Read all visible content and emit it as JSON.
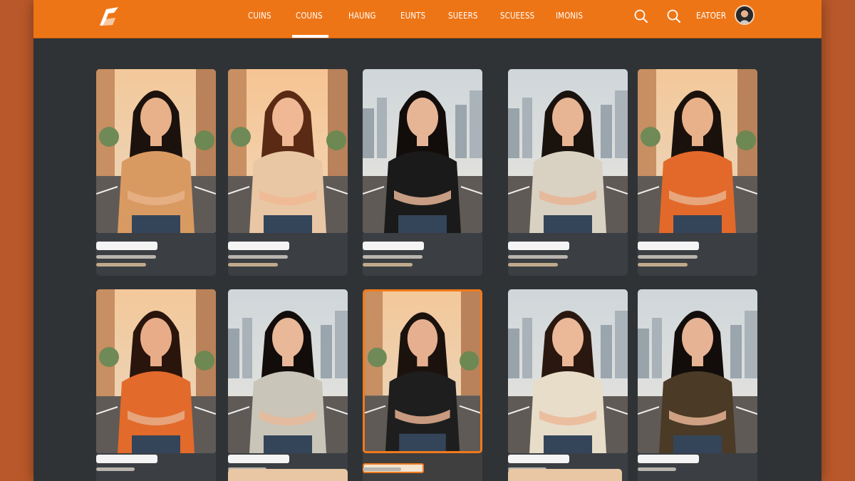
{
  "nav": {
    "items": [
      {
        "label": "CUINS"
      },
      {
        "label": "COUNS"
      },
      {
        "label": "HAUNG"
      },
      {
        "label": "EUNTS"
      },
      {
        "label": "SUEERS"
      },
      {
        "label": "SCUEESS"
      },
      {
        "label": "IMONIS"
      }
    ],
    "active_index": 1,
    "user_label": "EATOER"
  },
  "icons": {
    "logo": "brand-logo",
    "search_1": "search-icon",
    "search_2": "search-icon",
    "avatar": "user-avatar"
  },
  "colors": {
    "accent": "#ee7516",
    "background": "#2f3336",
    "card": "#3b3f43",
    "selected_border": "#f07a1c"
  },
  "profiles": [
    {
      "id": 1,
      "top": "#d99a62",
      "hair": "#1c120d",
      "skin": "#e8b189",
      "backdrop": "street",
      "selected": false
    },
    {
      "id": 2,
      "top": "#e9c6a4",
      "hair": "#5a2a14",
      "skin": "#f0b894",
      "backdrop": "sunset",
      "selected": false
    },
    {
      "id": 3,
      "top": "#1a1a1a",
      "hair": "#120d0a",
      "skin": "#e6b596",
      "backdrop": "city",
      "selected": false
    },
    {
      "id": 4,
      "top": "#d9d2c3",
      "hair": "#1a120d",
      "skin": "#e8b594",
      "backdrop": "city",
      "selected": false
    },
    {
      "id": 5,
      "top": "#e3692a",
      "hair": "#1a110c",
      "skin": "#e8b189",
      "backdrop": "street",
      "selected": false
    },
    {
      "id": 6,
      "top": "#e26a2b",
      "hair": "#2a150c",
      "skin": "#e8ad88",
      "backdrop": "street",
      "selected": false
    },
    {
      "id": 7,
      "top": "#c9c6b9",
      "hair": "#120d0a",
      "skin": "#e8b899",
      "backdrop": "city",
      "selected": false
    },
    {
      "id": 8,
      "top": "#1e1e1e",
      "hair": "#1c120d",
      "skin": "#e6b090",
      "backdrop": "street",
      "selected": true
    },
    {
      "id": 9,
      "top": "#e8ddc8",
      "hair": "#2a1810",
      "skin": "#ebb898",
      "backdrop": "city",
      "selected": false
    },
    {
      "id": 10,
      "top": "#4a3a26",
      "hair": "#120d0a",
      "skin": "#e6b394",
      "backdrop": "city",
      "selected": false
    }
  ]
}
